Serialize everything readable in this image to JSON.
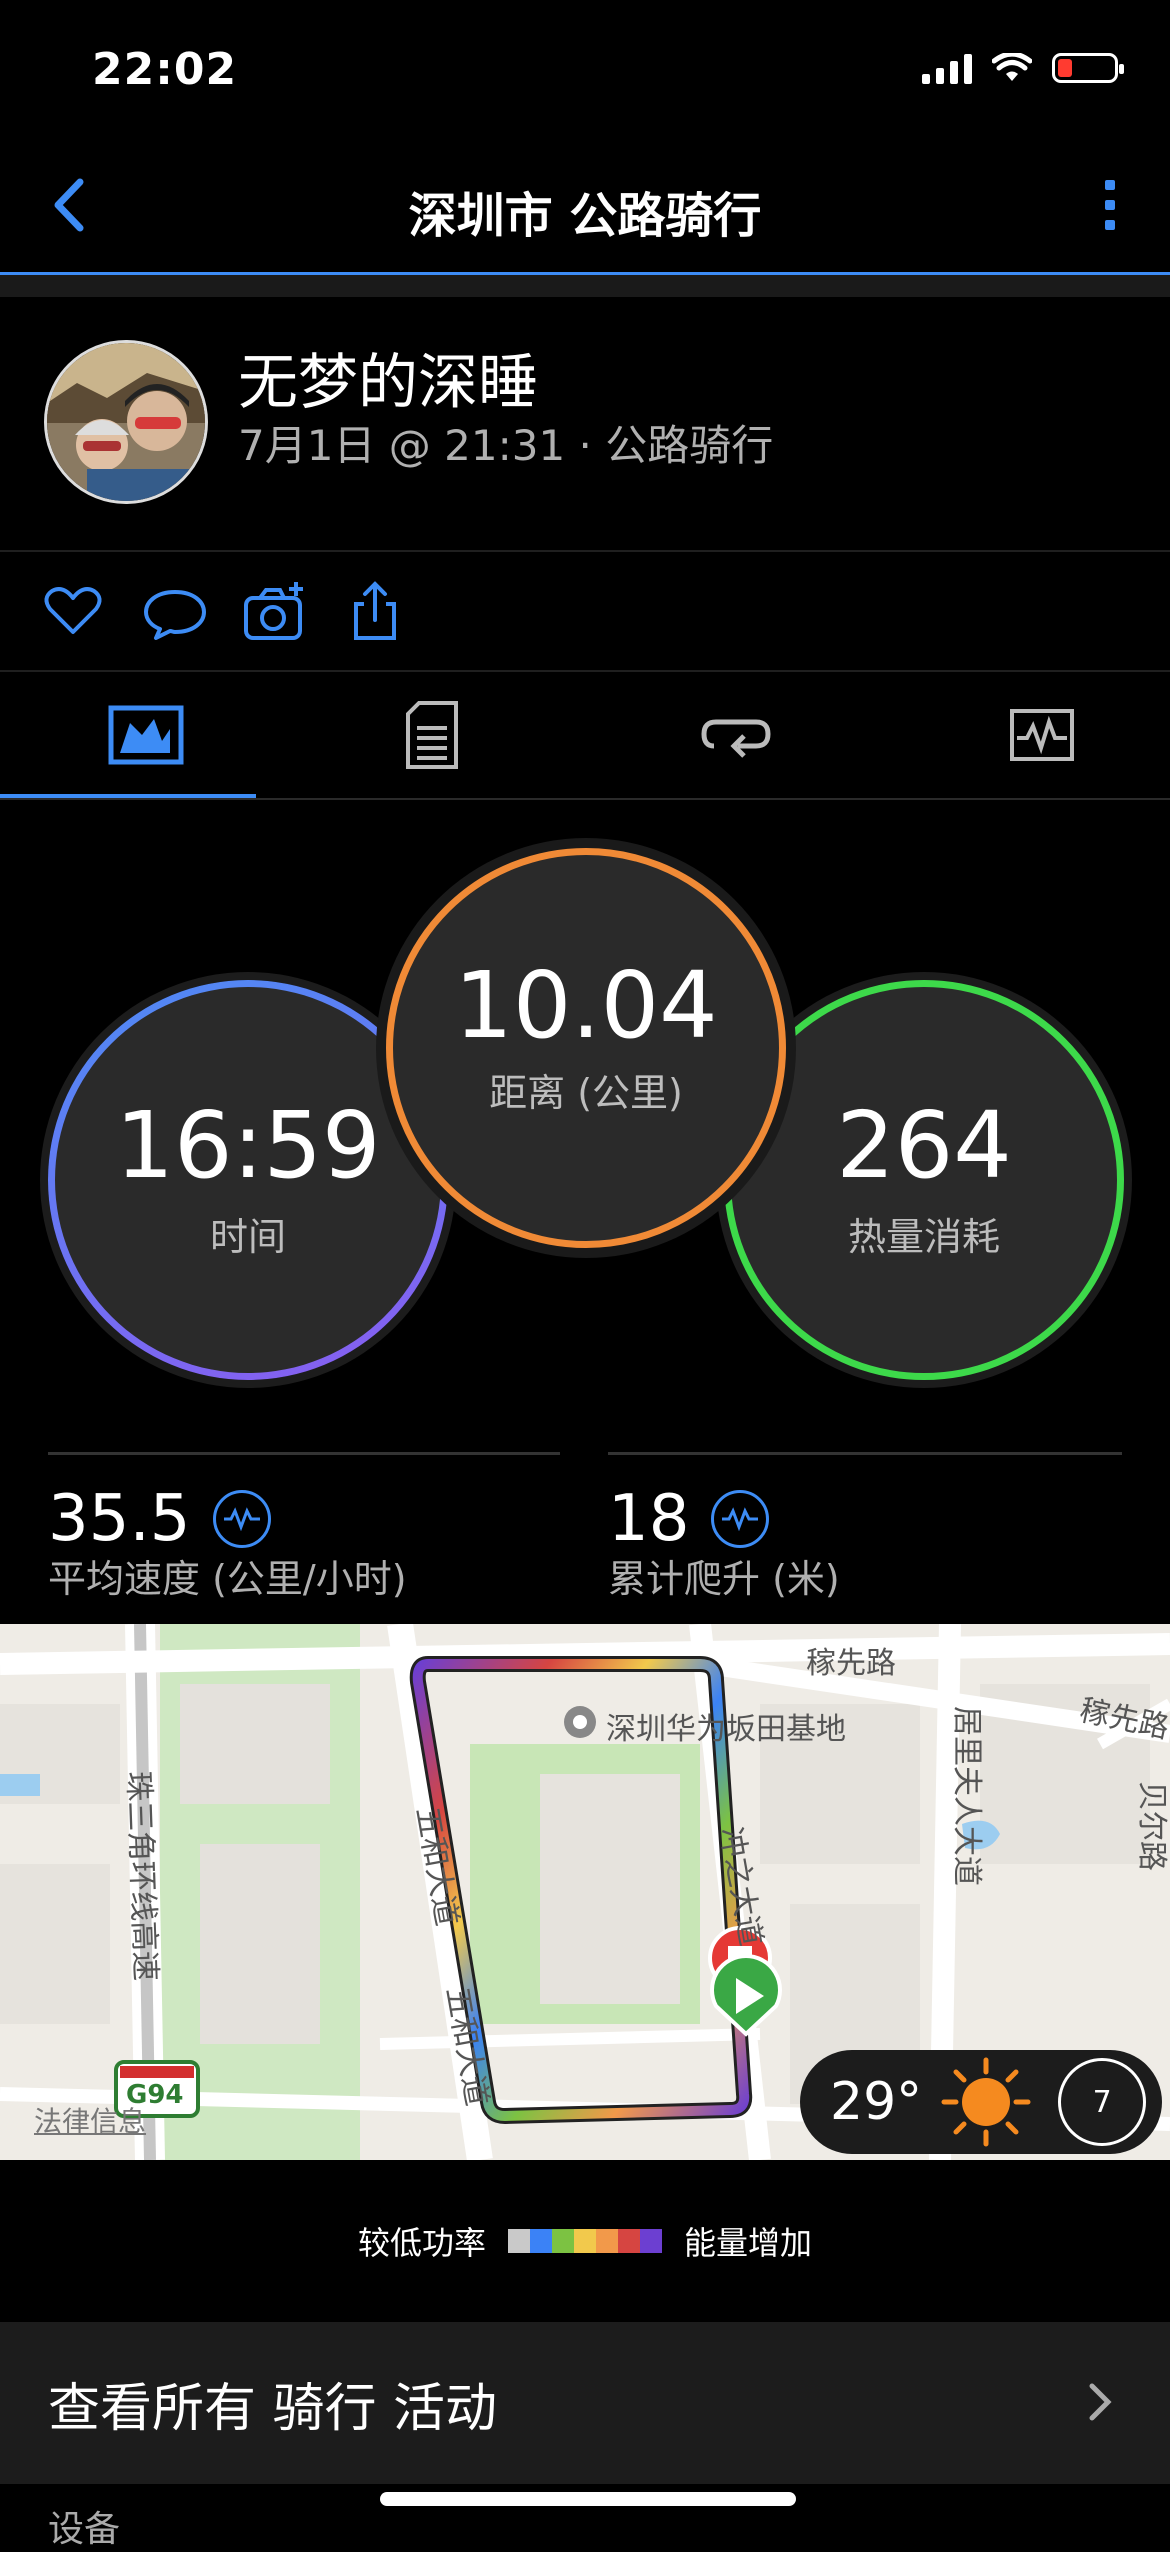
{
  "status_bar": {
    "time": "22:02"
  },
  "nav": {
    "title": "深圳市 公路骑行"
  },
  "profile": {
    "name": "无梦的深睡",
    "meta": "7月1日 @ 21:31 · 公路骑行"
  },
  "actions": [
    "heart-icon",
    "comment-icon",
    "camera-add-icon",
    "share-icon"
  ],
  "tabs": [
    "overview-chart-icon",
    "details-list-icon",
    "laps-loop-icon",
    "graph-icon"
  ],
  "rings": {
    "time": {
      "value": "16:59",
      "label": "时间"
    },
    "distance": {
      "value": "10.04",
      "label": "距离 (公里)"
    },
    "calories": {
      "value": "264",
      "label": "热量消耗"
    }
  },
  "stats": {
    "speed": {
      "value": "35.5",
      "label": "平均速度 (公里/小时)"
    },
    "ascent": {
      "value": "18",
      "label": "累计爬升 (米)"
    }
  },
  "map": {
    "labels": {
      "road1": "稼先路",
      "road2": "稼先路",
      "poi": "深圳华为坂田基地",
      "road3": "冲之大道",
      "road4": "五和大道",
      "road5": "五和大道",
      "road6": "珠三角环线高速",
      "road7": "居里夫人大道",
      "road8": "贝尔路",
      "highway": "G94",
      "legal": "法律信息"
    },
    "weather": {
      "temp": "29°",
      "wind": "7"
    }
  },
  "legend": {
    "low": "较低功率",
    "high": "能量增加",
    "colors": [
      "#c9c9c9",
      "#3b82f6",
      "#7cc242",
      "#f2c94c",
      "#f2994a",
      "#d64541",
      "#6c3fd1"
    ]
  },
  "bottom": {
    "view_all": "查看所有 骑行 活动",
    "device": "设备"
  }
}
